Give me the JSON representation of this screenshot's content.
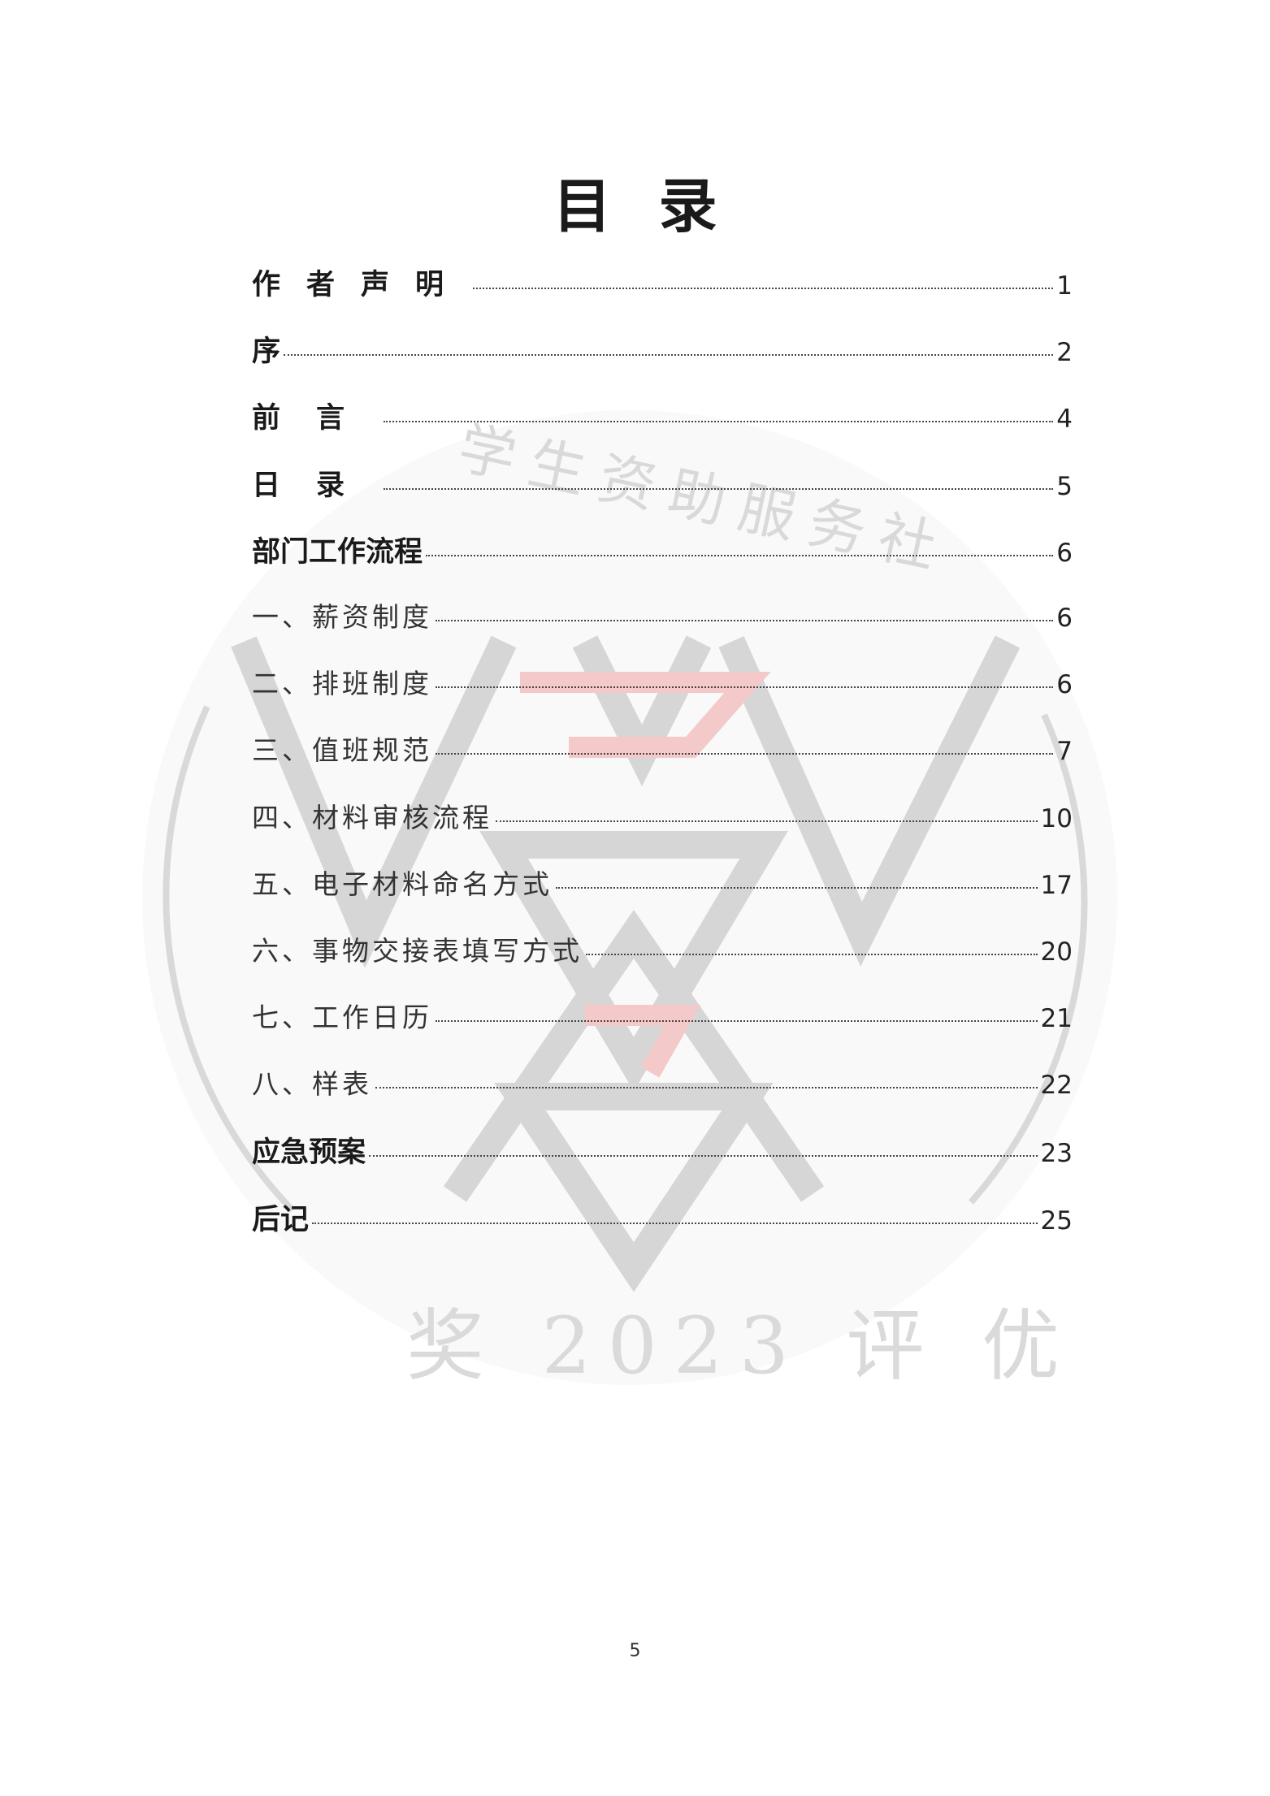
{
  "title": "目录",
  "toc": [
    {
      "label": "作者声明",
      "page": "1",
      "style": "bold spaced"
    },
    {
      "label": "序",
      "page": "2",
      "style": "bold"
    },
    {
      "label": "前言",
      "page": "4",
      "style": "bold spaced2"
    },
    {
      "label": "日录",
      "page": "5",
      "style": "bold spaced2"
    },
    {
      "label": "部门工作流程",
      "page": "6",
      "style": "bold"
    },
    {
      "label": "一、薪资制度",
      "page": "6",
      "style": "sub"
    },
    {
      "label": "二、排班制度",
      "page": "6",
      "style": "sub"
    },
    {
      "label": "三、值班规范",
      "page": "7",
      "style": "sub"
    },
    {
      "label": "四、材料审核流程",
      "page": "10",
      "style": "sub"
    },
    {
      "label": "五、电子材料命名方式",
      "page": "17",
      "style": "sub"
    },
    {
      "label": "六、事物交接表填写方式",
      "page": "20",
      "style": "sub"
    },
    {
      "label": "七、工作日历",
      "page": "21",
      "style": "sub"
    },
    {
      "label": "八、样表",
      "page": "22",
      "style": "sub"
    },
    {
      "label": "应急预案",
      "page": "23",
      "style": "bold"
    },
    {
      "label": "后记",
      "page": "25",
      "style": "bold"
    }
  ],
  "watermark": {
    "top_text": "学生资助服务社",
    "bottom_text": "奖 2023 评 优",
    "gray": "#d9d9d9",
    "red": "#f3c9c9"
  },
  "footer": {
    "page_number": "5"
  }
}
